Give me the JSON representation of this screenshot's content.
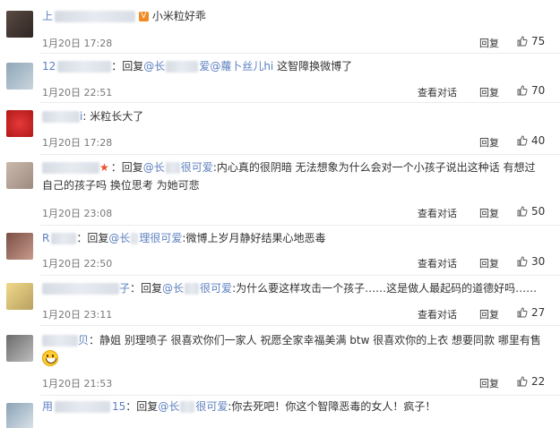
{
  "common": {
    "reply_label": "回复",
    "view_thread_label": "查看对话",
    "reply_prefix": "：回复",
    "mention_char": "@"
  },
  "comments": [
    {
      "name_visible": "上",
      "text": "小米粒好乖",
      "time": "1月20日 17:28",
      "likes": "75",
      "has_view_thread": false,
      "vbadge": "V"
    },
    {
      "name_visible": "12",
      "reply_to": "长",
      "reply_to_tail": "爱",
      "mention2": "@蘿卜丝儿hi",
      "text": "这智障换微博了",
      "time": "1月20日 22:51",
      "likes": "70",
      "has_view_thread": true
    },
    {
      "name_visible": "",
      "name_tail": "i",
      "text": "米粒长大了",
      "time": "1月20日 17:28",
      "likes": "40",
      "has_view_thread": false
    },
    {
      "name_visible": "",
      "reply_to": "长",
      "reply_to_tail": "很可爱",
      "text": "内心真的很阴暗 无法想象为什么会对一个小孩子说出这种话 有想过自己的孩子吗 换位思考 为她可悲",
      "time": "1月20日 23:08",
      "likes": "50",
      "has_view_thread": true
    },
    {
      "name_visible": "R",
      "reply_to": "长",
      "reply_to_tail": "理很可爱",
      "text": "微博上岁月静好结果心地恶毒",
      "time": "1月20日 22:50",
      "likes": "30",
      "has_view_thread": true
    },
    {
      "name_visible": "",
      "name_tail": "子",
      "reply_to": "长",
      "reply_to_tail": "很可爱",
      "text": "为什么要这样攻击一个孩子……这是做人最起码的道德好吗……",
      "time": "1月20日 23:11",
      "likes": "27",
      "has_view_thread": true
    },
    {
      "name_visible": "",
      "name_tail": "贝",
      "text": "静姐 别理喷子 很喜欢你们一家人 祝愿全家幸福美满 btw 很喜欢你的上衣 想要同款 哪里有售呀",
      "time": "1月20日 21:53",
      "likes": "22",
      "has_view_thread": false,
      "emoji": "grin-emoji"
    },
    {
      "name_visible": "用",
      "name_tail": "15",
      "reply_to": "长",
      "reply_to_tail": "很可爱",
      "text": "你去死吧！你这个智障恶毒的女人！疯子！"
    }
  ]
}
